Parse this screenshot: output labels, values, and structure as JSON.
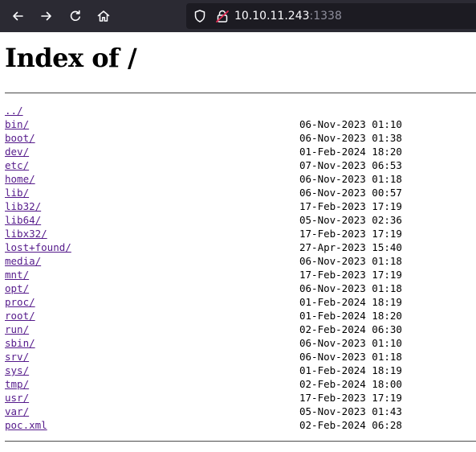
{
  "browser": {
    "url_host": "10.10.11.243",
    "url_port": ":1338",
    "icons": [
      "back-arrow-icon",
      "forward-arrow-icon",
      "reload-icon",
      "home-icon",
      "shield-icon",
      "insecure-lock-icon"
    ]
  },
  "page": {
    "title": "Index of /",
    "entries": [
      {
        "name": "../",
        "date": ""
      },
      {
        "name": "bin/",
        "date": "06-Nov-2023 01:10"
      },
      {
        "name": "boot/",
        "date": "06-Nov-2023 01:38"
      },
      {
        "name": "dev/",
        "date": "01-Feb-2024 18:20"
      },
      {
        "name": "etc/",
        "date": "07-Nov-2023 06:53"
      },
      {
        "name": "home/",
        "date": "06-Nov-2023 01:18"
      },
      {
        "name": "lib/",
        "date": "06-Nov-2023 00:57"
      },
      {
        "name": "lib32/",
        "date": "17-Feb-2023 17:19"
      },
      {
        "name": "lib64/",
        "date": "05-Nov-2023 02:36"
      },
      {
        "name": "libx32/",
        "date": "17-Feb-2023 17:19"
      },
      {
        "name": "lost+found/",
        "date": "27-Apr-2023 15:40"
      },
      {
        "name": "media/",
        "date": "06-Nov-2023 01:18"
      },
      {
        "name": "mnt/",
        "date": "17-Feb-2023 17:19"
      },
      {
        "name": "opt/",
        "date": "06-Nov-2023 01:18"
      },
      {
        "name": "proc/",
        "date": "01-Feb-2024 18:19"
      },
      {
        "name": "root/",
        "date": "01-Feb-2024 18:20"
      },
      {
        "name": "run/",
        "date": "02-Feb-2024 06:30"
      },
      {
        "name": "sbin/",
        "date": "06-Nov-2023 01:10"
      },
      {
        "name": "srv/",
        "date": "06-Nov-2023 01:18"
      },
      {
        "name": "sys/",
        "date": "01-Feb-2024 18:19"
      },
      {
        "name": "tmp/",
        "date": "02-Feb-2024 18:00"
      },
      {
        "name": "usr/",
        "date": "17-Feb-2023 17:19"
      },
      {
        "name": "var/",
        "date": "05-Nov-2023 01:43"
      },
      {
        "name": "poc.xml",
        "date": "02-Feb-2024 06:28"
      }
    ]
  },
  "colors": {
    "toolbar_bg": "#2b2a33",
    "urlbar_bg": "#1c1b22",
    "link_visited": "#551a8b",
    "insecure_lock": "#e22850"
  }
}
